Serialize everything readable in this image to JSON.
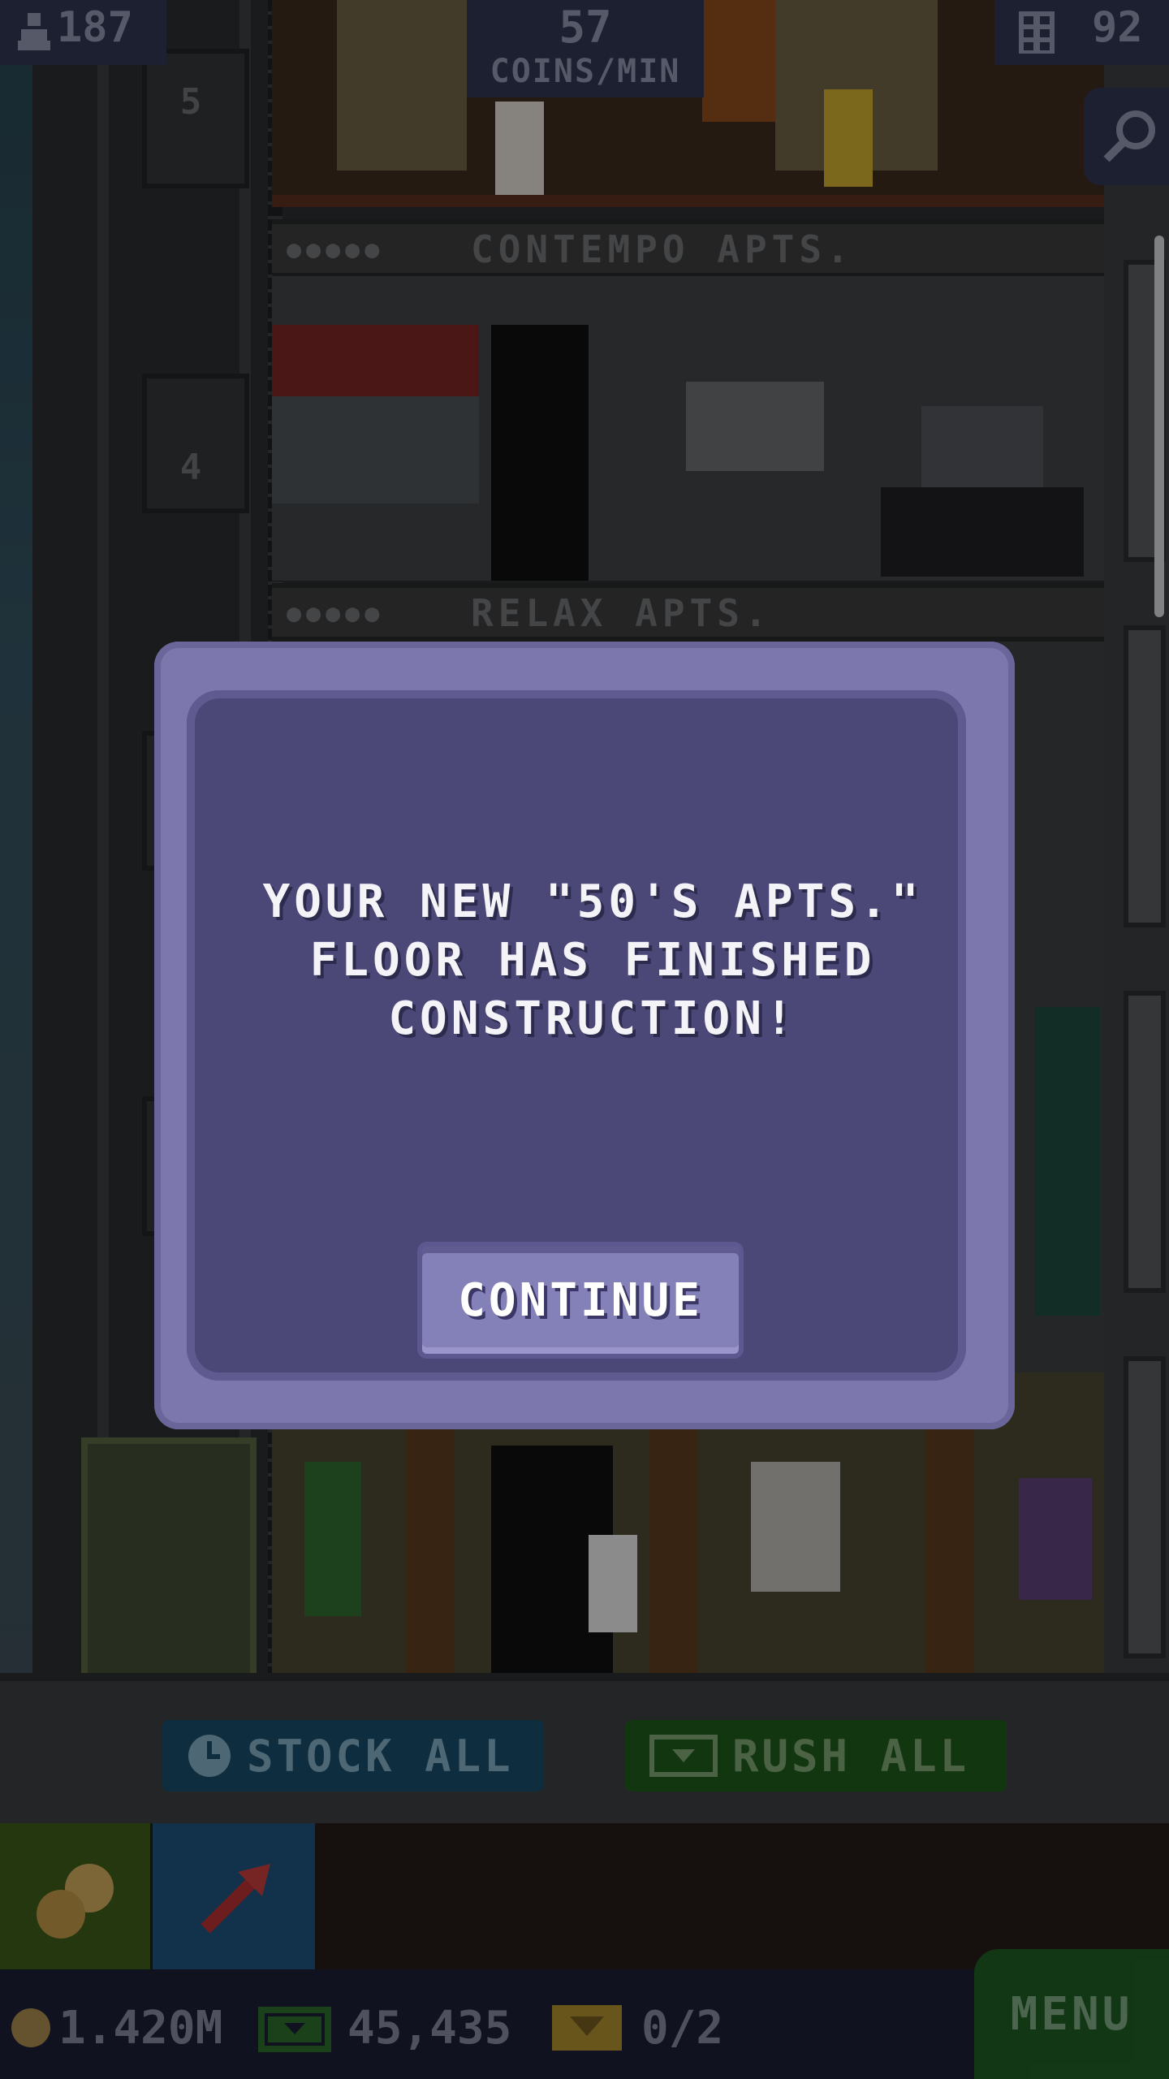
{
  "hud": {
    "population": "187",
    "coin_rate_value": "57",
    "coin_rate_label": "COINS/MIN",
    "floor_count": "92"
  },
  "tower": {
    "floor_numbers": [
      "5",
      "4"
    ],
    "floor_labels": [
      "CONTEMPO APTS.",
      "RELAX APTS."
    ],
    "resident_dots": "●●●●●"
  },
  "dialog": {
    "message_line1": "YOUR NEW \"50'S APTS.\"",
    "message_line2": "FLOOR HAS FINISHED",
    "message_line3": "CONSTRUCTION!",
    "continue_label": "CONTINUE"
  },
  "actions": {
    "stock_all_label": "STOCK ALL",
    "rush_all_label": "RUSH ALL"
  },
  "status": {
    "coins": "1.420M",
    "bux": "45,435",
    "tickets": "0/2",
    "menu_label": "MENU"
  },
  "colors": {
    "dialog_outer": "#7c78ad",
    "dialog_inner": "#4b4878",
    "stock_blue": "#174a66",
    "rush_green": "#1e5a1a",
    "menu_green": "#1d5a22"
  },
  "icons": {
    "population": "person-icon",
    "floors": "building-icon",
    "search": "magnifier-icon",
    "stock": "clock-icon",
    "rush": "ticket-arrow-icon",
    "coins": "coin-icon",
    "bux": "bux-icon",
    "tickets": "ticket-icon",
    "build": "build-arrow-icon"
  }
}
